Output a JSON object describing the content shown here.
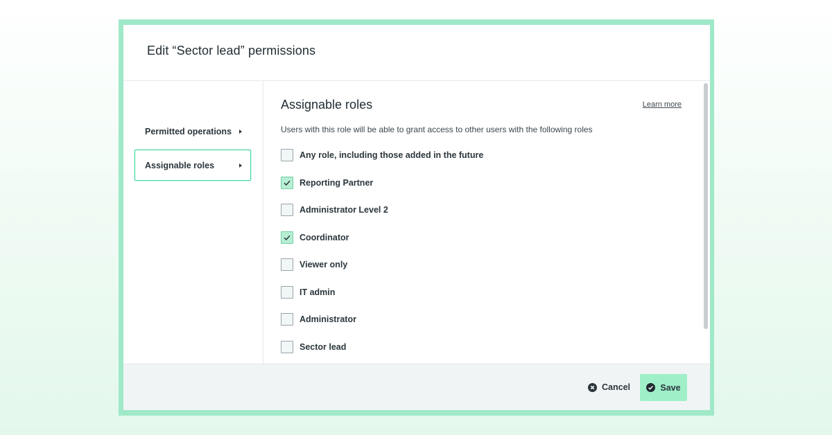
{
  "dialog": {
    "title": "Edit “Sector lead” permissions"
  },
  "sidebar": {
    "items": [
      {
        "label": "Permitted operations",
        "active": false
      },
      {
        "label": "Assignable roles",
        "active": true
      }
    ]
  },
  "main": {
    "title": "Assignable roles",
    "learn_more": "Learn more",
    "description": "Users with this role will be able to grant access to other users with the following roles",
    "roles": [
      {
        "label": "Any role, including those added in the future",
        "checked": false
      },
      {
        "label": "Reporting Partner",
        "checked": true
      },
      {
        "label": "Administrator Level 2",
        "checked": false
      },
      {
        "label": "Coordinator",
        "checked": true
      },
      {
        "label": "Viewer only",
        "checked": false
      },
      {
        "label": "IT admin",
        "checked": false
      },
      {
        "label": "Administrator",
        "checked": false
      },
      {
        "label": "Sector lead",
        "checked": false
      }
    ]
  },
  "footer": {
    "cancel_label": "Cancel",
    "save_label": "Save"
  },
  "icons": {
    "nav_arrow": "caret-right-icon",
    "checkbox_check": "check-icon",
    "cancel": "close-circle-icon",
    "save": "check-circle-icon"
  },
  "colors": {
    "accent": "#3ed69a",
    "frame": "#9fe8c8",
    "save_button": "#9ff0c9",
    "checked_box": "#b8efd4"
  }
}
